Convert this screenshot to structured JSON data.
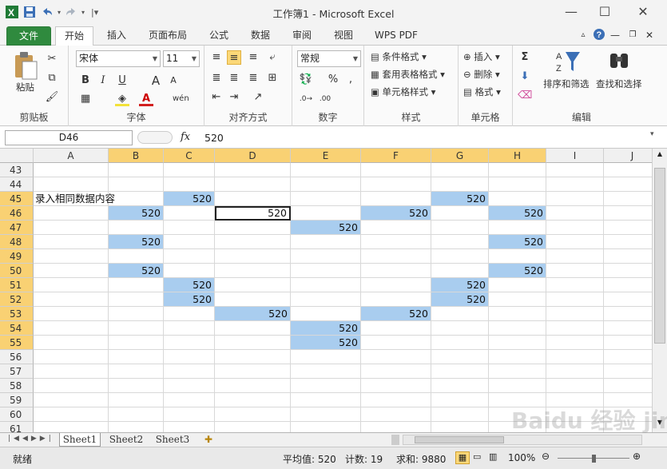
{
  "app": {
    "title": "工作簿1 - Microsoft Excel"
  },
  "tabs": [
    "文件",
    "开始",
    "插入",
    "页面布局",
    "公式",
    "数据",
    "审阅",
    "视图",
    "WPS PDF"
  ],
  "ribbon": {
    "clipboard": {
      "label": "剪贴板",
      "paste": "粘贴"
    },
    "font": {
      "label": "字体",
      "name": "宋体",
      "size": "11",
      "bold": "B",
      "italic": "I",
      "underline": "U",
      "grow": "A",
      "shrink": "A",
      "phonetic": "wén"
    },
    "alignment": {
      "label": "对齐方式"
    },
    "number": {
      "label": "数字",
      "format": "常规",
      "percent": "%"
    },
    "styles": {
      "label": "样式",
      "cond_format": "条件格式",
      "table_format": "套用表格格式",
      "cell_styles": "单元格样式"
    },
    "cells": {
      "label": "单元格",
      "insert": "插入",
      "delete": "删除",
      "format": "格式"
    },
    "editing": {
      "label": "编辑",
      "sort_filter": "排序和筛选",
      "find_select": "查找和选择",
      "sum": "Σ"
    }
  },
  "formula_bar": {
    "name_box": "D46",
    "fx": "fx",
    "value": "520"
  },
  "grid": {
    "columns": [
      "A",
      "B",
      "C",
      "D",
      "E",
      "F",
      "G",
      "H",
      "I",
      "J"
    ],
    "highlighted_columns": [
      "B",
      "C",
      "D",
      "E",
      "F",
      "G",
      "H"
    ],
    "rows": [
      "43",
      "44",
      "45",
      "46",
      "47",
      "48",
      "49",
      "50",
      "51",
      "52",
      "53",
      "54",
      "55",
      "56",
      "57",
      "58",
      "59",
      "60",
      "61"
    ],
    "highlighted_rows": [
      "45",
      "46",
      "47",
      "48",
      "49",
      "50",
      "51",
      "52",
      "53",
      "54",
      "55"
    ],
    "label_cell": {
      "ref": "A45",
      "text": "录入相同数据内容"
    },
    "filled_value": "520",
    "filled_cells": [
      "C45",
      "G45",
      "B46",
      "D46",
      "F46",
      "H46",
      "E47",
      "B48",
      "H48",
      "B50",
      "H50",
      "C51",
      "G51",
      "C52",
      "G52",
      "D53",
      "F53",
      "E54",
      "E55"
    ],
    "active_cell": "D46",
    "fill_color": "#a9cdef"
  },
  "sheets": [
    "Sheet1",
    "Sheet2",
    "Sheet3"
  ],
  "status": {
    "ready": "就绪",
    "average": "平均值: 520",
    "count": "计数: 19",
    "sum": "求和: 9880",
    "zoom": "100%"
  },
  "watermark": "Baidu 经验 jingyan.baidu.com"
}
